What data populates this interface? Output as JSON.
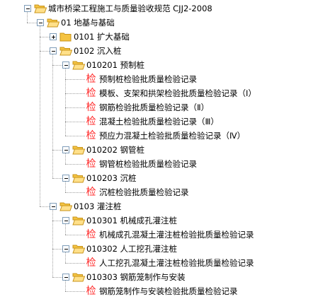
{
  "tree": {
    "nodes": [
      {
        "label": "城市桥梁工程施工与质量验收规范 CJJ2-2008",
        "level": 0,
        "type": "folder",
        "state": "expanded"
      },
      {
        "label": "01 地基与基础",
        "level": 1,
        "type": "folder",
        "state": "expanded"
      },
      {
        "label": "0101 扩大基础",
        "level": 2,
        "type": "folder",
        "state": "collapsed"
      },
      {
        "label": "0102 沉入桩",
        "level": 2,
        "type": "folder",
        "state": "expanded"
      },
      {
        "label": "010201 预制桩",
        "level": 3,
        "type": "folder",
        "state": "expanded"
      },
      {
        "label": "预制桩检验批质量检验记录",
        "level": 4,
        "type": "doc"
      },
      {
        "label": "模板、支架和拱架检验批质量检验记录（Ⅰ）",
        "level": 4,
        "type": "doc"
      },
      {
        "label": "钢筋检验批质量检验记录（Ⅱ）",
        "level": 4,
        "type": "doc"
      },
      {
        "label": "混凝土检验批质量检验记录（Ⅲ）",
        "level": 4,
        "type": "doc"
      },
      {
        "label": "预应力混凝土检验批质量检验记录（Ⅳ）",
        "level": 4,
        "type": "doc"
      },
      {
        "label": "010202 钢管桩",
        "level": 3,
        "type": "folder",
        "state": "expanded"
      },
      {
        "label": "钢管桩检验批质量检验记录",
        "level": 4,
        "type": "doc"
      },
      {
        "label": "010203 沉桩",
        "level": 3,
        "type": "folder",
        "state": "expanded"
      },
      {
        "label": "沉桩检验批质量检验记录",
        "level": 4,
        "type": "doc"
      },
      {
        "label": "0103 灌注桩",
        "level": 2,
        "type": "folder",
        "state": "expanded"
      },
      {
        "label": "010301 机械成孔灌注桩",
        "level": 3,
        "type": "folder",
        "state": "expanded"
      },
      {
        "label": "机械成孔混凝土灌注桩检验批质量检验记录",
        "level": 4,
        "type": "doc"
      },
      {
        "label": "010302 人工挖孔灌注桩",
        "level": 3,
        "type": "folder",
        "state": "expanded"
      },
      {
        "label": "人工挖孔混凝土灌注桩检验批质量检验记录",
        "level": 4,
        "type": "doc"
      },
      {
        "label": "010303 钢筋笼制作与安装",
        "level": 3,
        "type": "folder",
        "state": "expanded"
      },
      {
        "label": "钢筋笼制作与安装检验批质量检验记录",
        "level": 4,
        "type": "doc"
      }
    ]
  },
  "icons": {
    "folder_open": "folder-open-icon",
    "folder_closed": "folder-closed-icon",
    "document": "inspection-record-icon",
    "document_glyph": "检"
  },
  "colors": {
    "folder_fill": "#f5c341",
    "folder_edge": "#c8941a",
    "doc_icon": "#ff2a2a",
    "tree_line": "#a0a0a0",
    "expander_border": "#7f9db9"
  }
}
